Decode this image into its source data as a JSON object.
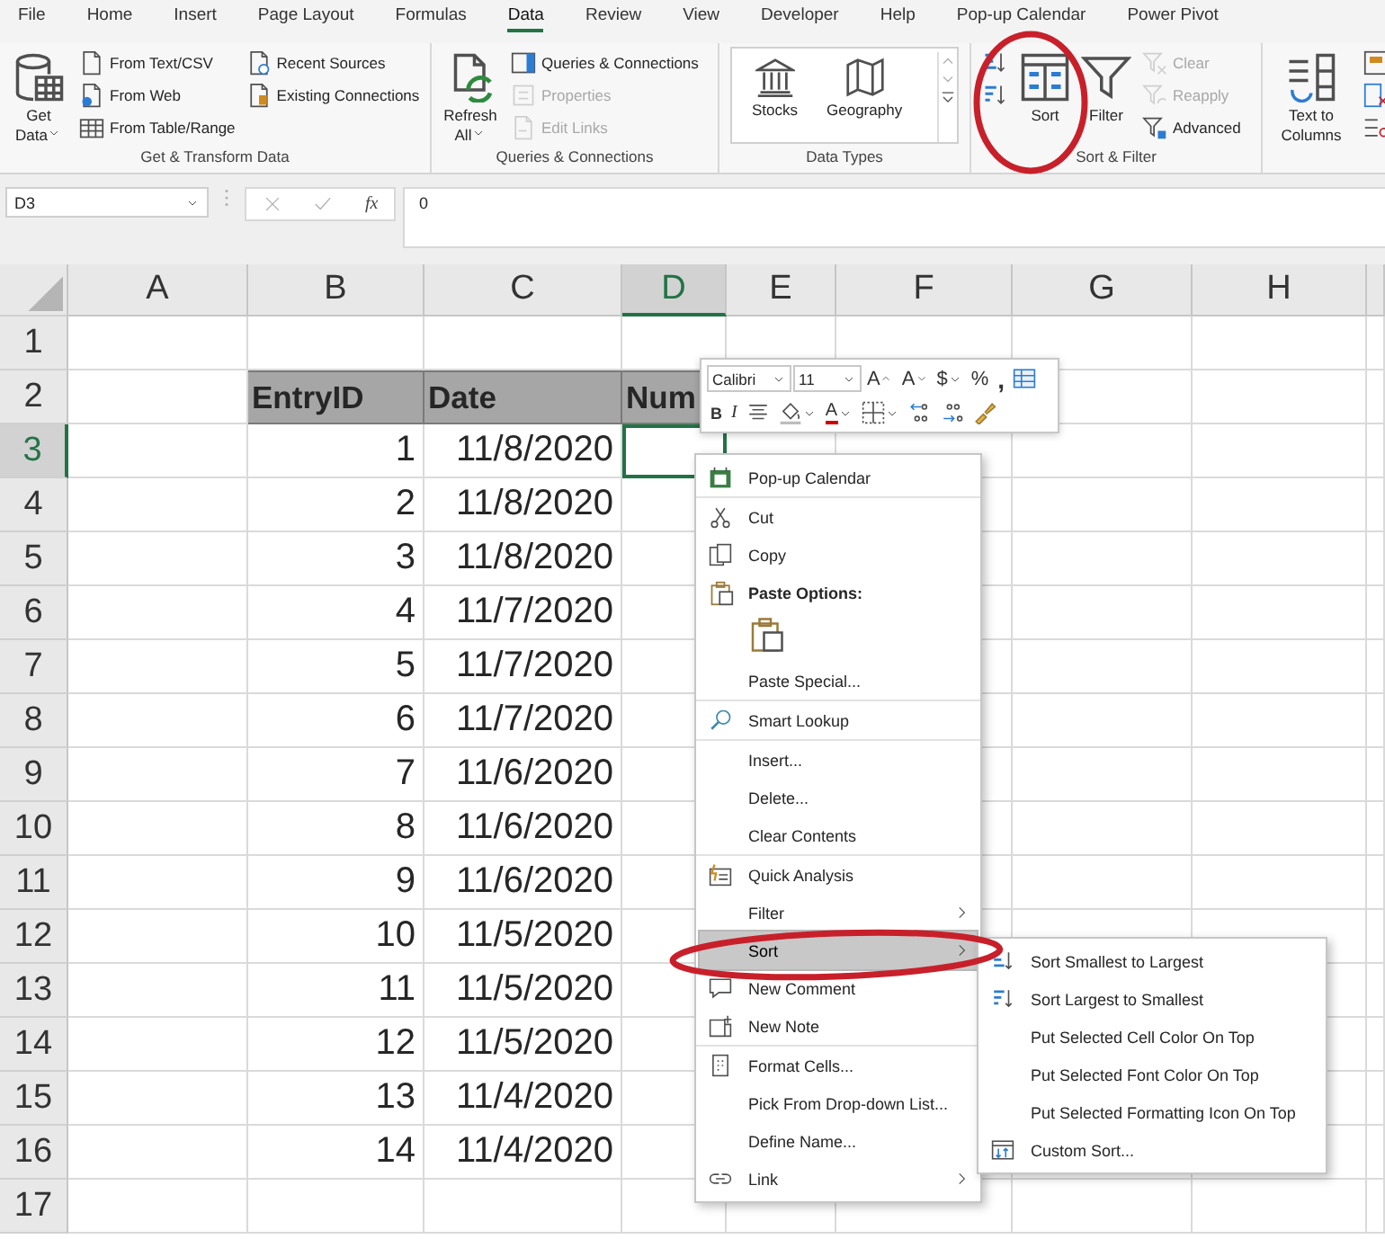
{
  "ribbon": {
    "tabs": [
      {
        "label": "File",
        "selected": false
      },
      {
        "label": "Home",
        "selected": false
      },
      {
        "label": "Insert",
        "selected": false
      },
      {
        "label": "Page Layout",
        "selected": false
      },
      {
        "label": "Formulas",
        "selected": false
      },
      {
        "label": "Data",
        "selected": true
      },
      {
        "label": "Review",
        "selected": false
      },
      {
        "label": "View",
        "selected": false
      },
      {
        "label": "Developer",
        "selected": false
      },
      {
        "label": "Help",
        "selected": false
      },
      {
        "label": "Pop-up Calendar",
        "selected": false
      },
      {
        "label": "Power Pivot",
        "selected": false
      }
    ],
    "groups": [
      {
        "label": "Get & Transform Data",
        "kind": "standard",
        "columns": [
          [
            {
              "kind": "large",
              "label": "Get Data",
              "dropdown": true,
              "disabled": false
            }
          ],
          [
            {
              "kind": "small",
              "label": "From Text/CSV",
              "dropdown": false,
              "disabled": false
            },
            {
              "kind": "small",
              "label": "From Web",
              "dropdown": false,
              "disabled": false
            },
            {
              "kind": "small",
              "label": "From Table/Range",
              "dropdown": false,
              "disabled": false
            }
          ],
          [
            {
              "kind": "small",
              "label": "Recent Sources",
              "dropdown": false,
              "disabled": false
            },
            {
              "kind": "small",
              "label": "Existing Connections",
              "dropdown": false,
              "disabled": false
            }
          ]
        ]
      },
      {
        "label": "Queries & Connections",
        "kind": "standard",
        "columns": [
          [
            {
              "kind": "large",
              "label": "Refresh All",
              "dropdown": true,
              "disabled": false
            }
          ],
          [
            {
              "kind": "small",
              "label": "Queries & Connections",
              "dropdown": false,
              "disabled": false
            },
            {
              "kind": "small",
              "label": "Properties",
              "dropdown": false,
              "disabled": true
            },
            {
              "kind": "small",
              "label": "Edit Links",
              "dropdown": false,
              "disabled": true
            }
          ]
        ]
      },
      {
        "label": "Data Types",
        "kind": "gallery",
        "columns": [
          [
            {
              "kind": "large",
              "label": "Stocks",
              "dropdown": false,
              "disabled": false
            }
          ],
          [
            {
              "kind": "large",
              "label": "Geography",
              "dropdown": false,
              "disabled": false
            }
          ]
        ]
      },
      {
        "label": "Sort & Filter",
        "kind": "standard",
        "columns": [
          [
            {
              "kind": "icon"
            },
            {
              "kind": "icon"
            }
          ],
          [
            {
              "kind": "large",
              "label": "Sort",
              "dropdown": false,
              "disabled": false
            }
          ],
          [
            {
              "kind": "large",
              "label": "Filter",
              "dropdown": false,
              "disabled": false
            }
          ],
          [
            {
              "kind": "small",
              "label": "Clear",
              "dropdown": false,
              "disabled": true
            },
            {
              "kind": "small",
              "label": "Reapply",
              "dropdown": false,
              "disabled": true
            },
            {
              "kind": "small",
              "label": "Advanced",
              "dropdown": false,
              "disabled": false
            }
          ]
        ]
      },
      {
        "kind": "standard",
        "columns": [
          [
            {
              "kind": "large",
              "label": "Text to Columns",
              "dropdown": false,
              "disabled": false
            }
          ],
          [
            {
              "kind": "icon"
            },
            {
              "kind": "icon"
            },
            {
              "kind": "icon"
            }
          ]
        ]
      }
    ]
  },
  "formula_bar": {
    "name_box": "D3",
    "function_label": "fx",
    "value": "0"
  },
  "sheet": {
    "columns": [
      {
        "label": "A",
        "selected": false
      },
      {
        "label": "B",
        "selected": false
      },
      {
        "label": "C",
        "selected": false
      },
      {
        "label": "D",
        "selected": true
      },
      {
        "label": "E",
        "selected": false
      },
      {
        "label": "F",
        "selected": false
      },
      {
        "label": "G",
        "selected": false
      },
      {
        "label": "H",
        "selected": false
      }
    ],
    "rows": [
      {
        "label": "1",
        "selected": false
      },
      {
        "label": "2",
        "kind": "header",
        "selected": false,
        "cells": [
          "EntryID",
          "Date",
          "Num"
        ]
      },
      {
        "label": "3",
        "kind": "data",
        "selected": true,
        "cells": [
          "1",
          "11/8/2020"
        ]
      },
      {
        "label": "4",
        "kind": "data",
        "selected": false,
        "cells": [
          "2",
          "11/8/2020"
        ]
      },
      {
        "label": "5",
        "kind": "data",
        "selected": false,
        "cells": [
          "3",
          "11/8/2020"
        ]
      },
      {
        "label": "6",
        "kind": "data",
        "selected": false,
        "cells": [
          "4",
          "11/7/2020"
        ]
      },
      {
        "label": "7",
        "kind": "data",
        "selected": false,
        "cells": [
          "5",
          "11/7/2020"
        ]
      },
      {
        "label": "8",
        "kind": "data",
        "selected": false,
        "cells": [
          "6",
          "11/7/2020"
        ]
      },
      {
        "label": "9",
        "kind": "data",
        "selected": false,
        "cells": [
          "7",
          "11/6/2020"
        ]
      },
      {
        "label": "10",
        "kind": "data",
        "selected": false,
        "cells": [
          "8",
          "11/6/2020"
        ]
      },
      {
        "label": "11",
        "kind": "data",
        "selected": false,
        "cells": [
          "9",
          "11/6/2020"
        ]
      },
      {
        "label": "12",
        "kind": "data",
        "selected": false,
        "cells": [
          "10",
          "11/5/2020"
        ]
      },
      {
        "label": "13",
        "kind": "data",
        "selected": false,
        "cells": [
          "11",
          "11/5/2020"
        ]
      },
      {
        "label": "14",
        "kind": "data",
        "selected": false,
        "cells": [
          "12",
          "11/5/2020"
        ]
      },
      {
        "label": "15",
        "kind": "data",
        "selected": false,
        "cells": [
          "13",
          "11/4/2020"
        ]
      },
      {
        "label": "16",
        "kind": "data",
        "selected": false,
        "cells": [
          "14",
          "11/4/2020"
        ]
      },
      {
        "label": "17",
        "selected": false
      }
    ]
  },
  "mini_toolbar": {
    "font": "Calibri",
    "size": "11",
    "row_1": [
      {
        "kind": "grow-font",
        "label": "A",
        "dropdown": false
      },
      {
        "kind": "shrink-font",
        "label": "A",
        "dropdown": false
      },
      {
        "kind": "currency",
        "label": "$",
        "dropdown": true
      },
      {
        "kind": "percent",
        "label": "%",
        "dropdown": false
      },
      {
        "kind": "comma",
        "label": ",",
        "dropdown": false
      },
      {
        "kind": "table-format",
        "dropdown": false
      }
    ],
    "row_2": [
      {
        "kind": "bold",
        "label": "B",
        "dropdown": false
      },
      {
        "kind": "italic",
        "label": "I",
        "dropdown": false
      },
      {
        "kind": "align-center",
        "dropdown": false
      },
      {
        "kind": "fill-bucket",
        "dropdown": true
      },
      {
        "kind": "font-color",
        "label": "A",
        "dropdown": true
      },
      {
        "kind": "borders",
        "dropdown": true
      },
      {
        "kind": "increase-decimal",
        "dropdown": false
      },
      {
        "kind": "decrease-decimal",
        "dropdown": false
      },
      {
        "kind": "paintbrush",
        "dropdown": false
      }
    ]
  },
  "context_menu": {
    "sections": [
      [
        {
          "kind": "calendar",
          "label": "Pop-up Calendar",
          "submenu": false,
          "selected": false
        }
      ],
      [
        {
          "kind": "scissors",
          "label": "Cut",
          "submenu": false,
          "selected": false
        },
        {
          "kind": "copy",
          "label": "Copy",
          "submenu": false,
          "selected": false
        },
        {
          "kind": "paste-header",
          "label": "Paste Options:"
        },
        {
          "kind": "paste-option",
          "selected": false
        },
        {
          "kind": "plain",
          "label": "Paste Special...",
          "submenu": false,
          "selected": false
        }
      ],
      [
        {
          "kind": "search",
          "label": "Smart Lookup",
          "submenu": false,
          "selected": false
        }
      ],
      [
        {
          "kind": "plain",
          "label": "Insert...",
          "submenu": false,
          "selected": false
        },
        {
          "kind": "plain",
          "label": "Delete...",
          "submenu": false,
          "selected": false
        },
        {
          "kind": "plain",
          "label": "Clear Contents",
          "submenu": false,
          "selected": false
        }
      ],
      [
        {
          "kind": "quick-analysis",
          "label": "Quick Analysis",
          "submenu": false,
          "selected": false
        },
        {
          "kind": "plain",
          "label": "Filter",
          "submenu": true,
          "selected": false
        },
        {
          "kind": "plain",
          "label": "Sort",
          "submenu": true,
          "selected": true
        },
        {
          "kind": "comment",
          "label": "New Comment",
          "submenu": false,
          "selected": false
        },
        {
          "kind": "note",
          "label": "New Note",
          "submenu": false,
          "selected": false
        }
      ],
      [
        {
          "kind": "format-cells",
          "label": "Format Cells...",
          "submenu": false,
          "selected": false
        },
        {
          "kind": "plain",
          "label": "Pick From Drop-down List...",
          "submenu": false,
          "selected": false
        },
        {
          "kind": "plain",
          "label": "Define Name...",
          "submenu": false,
          "selected": false
        },
        {
          "kind": "link",
          "label": "Link",
          "submenu": true,
          "selected": false
        }
      ]
    ]
  },
  "sort_submenu": {
    "items": [
      {
        "kind": "sort-ascending",
        "label": "Sort Smallest to Largest"
      },
      {
        "kind": "sort-descending",
        "label": "Sort Largest to Smallest"
      },
      {
        "kind": "plain",
        "label": "Put Selected Cell Color On Top"
      },
      {
        "kind": "plain",
        "label": "Put Selected Font Color On Top"
      },
      {
        "kind": "plain",
        "label": "Put Selected Formatting Icon On Top"
      },
      {
        "kind": "custom-sort",
        "label": "Custom Sort..."
      }
    ]
  }
}
